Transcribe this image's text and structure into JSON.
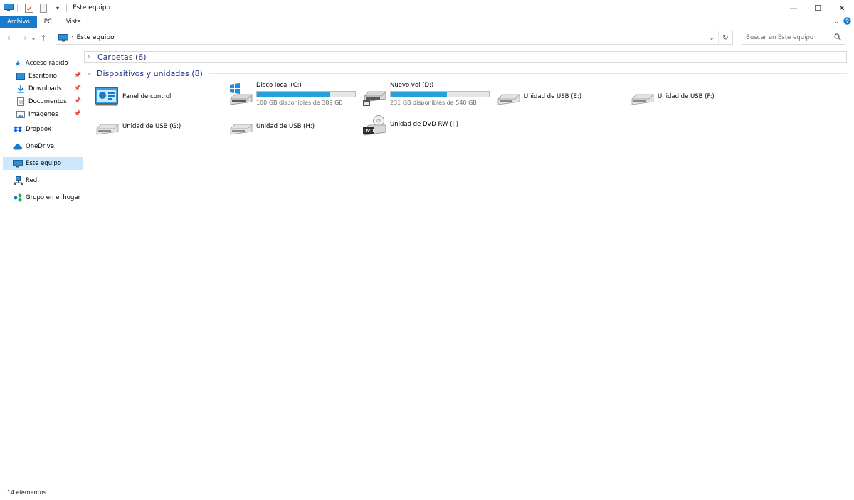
{
  "window": {
    "title": "Este equipo"
  },
  "ribbon": {
    "tabs": [
      {
        "label": "Archivo",
        "active": true
      },
      {
        "label": "PC"
      },
      {
        "label": "Vista"
      }
    ]
  },
  "address": {
    "path": "Este equipo"
  },
  "search": {
    "placeholder": "Buscar en Este equipo"
  },
  "nav": {
    "items": [
      {
        "label": "Acceso rápido",
        "icon": "star-icon"
      },
      {
        "label": "Escritorio",
        "icon": "desktop-icon",
        "pinned": true
      },
      {
        "label": "Downloads",
        "icon": "download-icon",
        "pinned": true
      },
      {
        "label": "Documentos",
        "icon": "document-icon",
        "pinned": true
      },
      {
        "label": "Imágenes",
        "icon": "image-icon",
        "pinned": true
      },
      {
        "label": "Dropbox",
        "icon": "dropbox-icon"
      },
      {
        "label": "OneDrive",
        "icon": "cloud-icon"
      },
      {
        "label": "Este equipo",
        "icon": "computer-icon",
        "selected": true
      },
      {
        "label": "Red",
        "icon": "network-icon"
      },
      {
        "label": "Grupo en el hogar",
        "icon": "homegroup-icon"
      }
    ]
  },
  "groups": {
    "folders": {
      "label": "Carpetas (6)"
    },
    "devices": {
      "label": "Dispositivos y unidades (8)"
    }
  },
  "devices": [
    {
      "name": "Panel de control",
      "icon": "control-panel-icon"
    },
    {
      "name": "Disco local (C:)",
      "icon": "windows-drive-icon",
      "free": "100 GB disponibles de 389 GB",
      "used_fraction": 0.74
    },
    {
      "name": "Nuevo vol (D:)",
      "icon": "drive-icon",
      "free": "231 GB disponibles de 540 GB",
      "used_fraction": 0.57
    },
    {
      "name": "Unidad de USB (E:)",
      "icon": "usb-drive-icon"
    },
    {
      "name": "Unidad de USB (F:)",
      "icon": "usb-drive-icon"
    },
    {
      "name": "Unidad de USB (G:)",
      "icon": "usb-drive-icon"
    },
    {
      "name": "Unidad de USB (H:)",
      "icon": "usb-drive-icon"
    },
    {
      "name": "Unidad de DVD RW (I:)",
      "icon": "dvd-drive-icon",
      "badge": "DVD"
    }
  ],
  "status": {
    "count": "14 elementos"
  },
  "colors": {
    "accent": "#1979ca",
    "bar_fill": "#26a0da",
    "selected": "#cce8ff",
    "group_text": "#1e3287"
  }
}
